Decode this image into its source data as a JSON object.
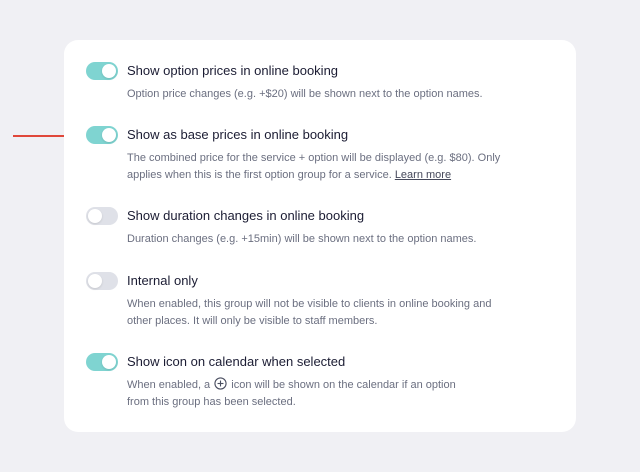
{
  "accent_color": "#7fd4d1",
  "arrow_color": "#e0473a",
  "settings": [
    {
      "enabled": true,
      "title": "Show option prices in online booking",
      "description": "Option price changes (e.g. +$20) will be shown next to the option names."
    },
    {
      "enabled": true,
      "title": "Show as base prices in online booking",
      "description_line1": "The combined price for the service + option will be displayed (e.g. $80). Only",
      "description_line2": "applies when this is the first option group for a service.",
      "link_label": "Learn more"
    },
    {
      "enabled": false,
      "title": "Show duration changes in online booking",
      "description": "Duration changes (e.g. +15min) will be shown next to the option names."
    },
    {
      "enabled": false,
      "title": "Internal only",
      "description_line1": "When enabled, this group will not be visible to clients in online booking and",
      "description_line2": "other places. It will only be visible to staff members."
    },
    {
      "enabled": true,
      "title": "Show icon on calendar when selected",
      "description_line1_before": "When enabled, a",
      "description_icon": "plus-circle-icon",
      "description_line1_after": "icon will be shown on the calendar if an option",
      "description_line2": "from this group has been selected."
    }
  ]
}
